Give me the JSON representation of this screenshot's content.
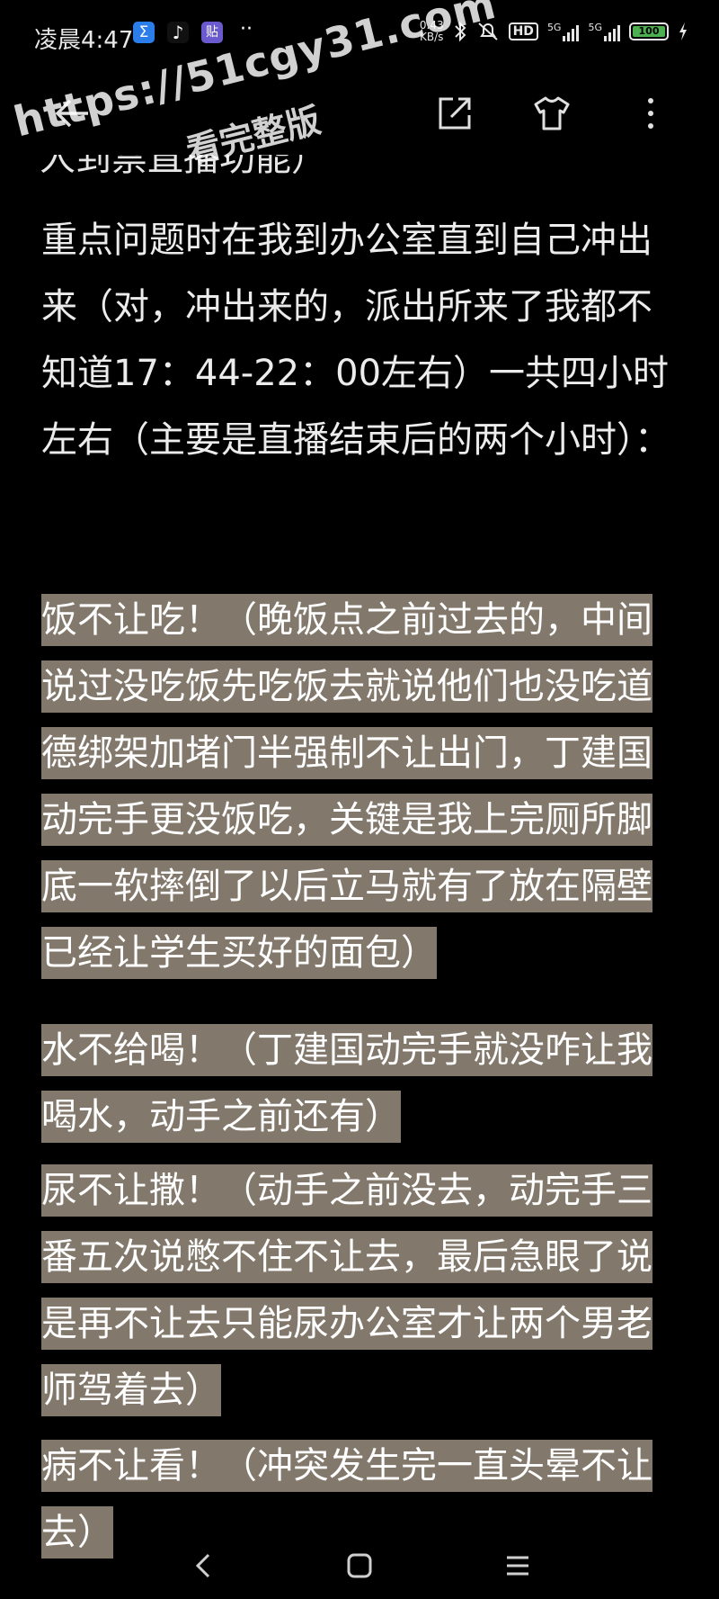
{
  "status_bar": {
    "time": "凌晨4:47",
    "app_icons": [
      {
        "name": "sigma-app-icon",
        "glyph": "Σ",
        "color": "#2b7de9"
      },
      {
        "name": "tiktok-icon",
        "glyph": "♪",
        "color": "#111111"
      },
      {
        "name": "bilibili-icon",
        "glyph": "贴",
        "color": "#6a5acd"
      },
      {
        "name": "more-notifications-icon",
        "glyph": "··",
        "color": "#000000"
      }
    ],
    "net_speed_value": "0.43",
    "net_speed_unit": "KB/s",
    "hd_label": "HD",
    "signal_1_label": "5G",
    "signal_2_label": "5G",
    "battery_level": "100"
  },
  "toolbar": {
    "back_icon": "back-arrow-icon",
    "share_icon": "share-icon",
    "shirt_icon": "shirt-icon",
    "more_icon": "more-vertical-icon"
  },
  "watermark": {
    "url": "https://51cgy31.com",
    "subtitle": "看完整版"
  },
  "content": {
    "cut_off_line": "人到禁直播功能）",
    "paragraphs": [
      {
        "highlighted": false,
        "text": "重点问题时在我到办公室直到自己冲出来（对，冲出来的，派出所来了我都不知道17：44-22：00左右）一共四小时左右（主要是直播结束后的两个小时）："
      },
      {
        "highlighted": true,
        "text": "饭不让吃！（晚饭点之前过去的，中间说过没吃饭先吃饭去就说他们也没吃道德绑架加堵门半强制不让出门，丁建国动完手更没饭吃，关键是我上完厕所脚底一软摔倒了以后立马就有了放在隔壁已经让学生买好的面包）"
      },
      {
        "highlighted": true,
        "text": "水不给喝！（丁建国动完手就没咋让我喝水，动手之前还有）"
      },
      {
        "highlighted": true,
        "text": "尿不让撒！（动手之前没去，动完手三番五次说憋不住不让去，最后急眼了说是再不让去只能尿办公室才让两个男老师驾着去）"
      },
      {
        "highlighted": true,
        "text": "病不让看！（冲突发生完一直头晕不让去）"
      }
    ]
  },
  "nav_bar": {
    "back_icon": "nav-back-icon",
    "home_icon": "nav-home-icon",
    "menu_icon": "nav-menu-icon"
  }
}
